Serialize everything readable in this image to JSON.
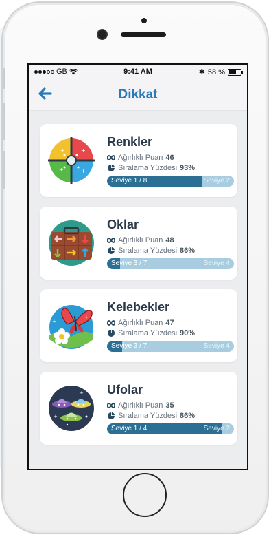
{
  "status": {
    "carrier": "GB",
    "time": "9:41 AM",
    "battery": "58 %"
  },
  "nav": {
    "title": "Dikkat"
  },
  "labels": {
    "weighted": "Ağırlıklı Puan",
    "rank": "Sıralama Yüzdesi"
  },
  "colors": {
    "accent": "#2a7ab8",
    "bar_fill": "#2b6f95",
    "bar_track": "#a8cde0"
  },
  "games": [
    {
      "title": "Renkler",
      "score": "46",
      "percentile": "93%",
      "level_current": "Seviye 1 / 8",
      "level_next": "Seviye 2",
      "progress": 0.75,
      "icon": "color-wheel-icon"
    },
    {
      "title": "Oklar",
      "score": "48",
      "percentile": "86%",
      "level_current": "Seviye 3 / 7",
      "level_next": "Seviye 4",
      "progress": 0.1,
      "icon": "arrows-suitcase-icon"
    },
    {
      "title": "Kelebekler",
      "score": "47",
      "percentile": "90%",
      "level_current": "Seviye 3 / 7",
      "level_next": "Seviye 4",
      "progress": 0.12,
      "icon": "butterfly-icon"
    },
    {
      "title": "Ufolar",
      "score": "35",
      "percentile": "86%",
      "level_current": "Seviye 1 / 4",
      "level_next": "Seviye 2",
      "progress": 0.9,
      "icon": "ufo-icon"
    }
  ]
}
